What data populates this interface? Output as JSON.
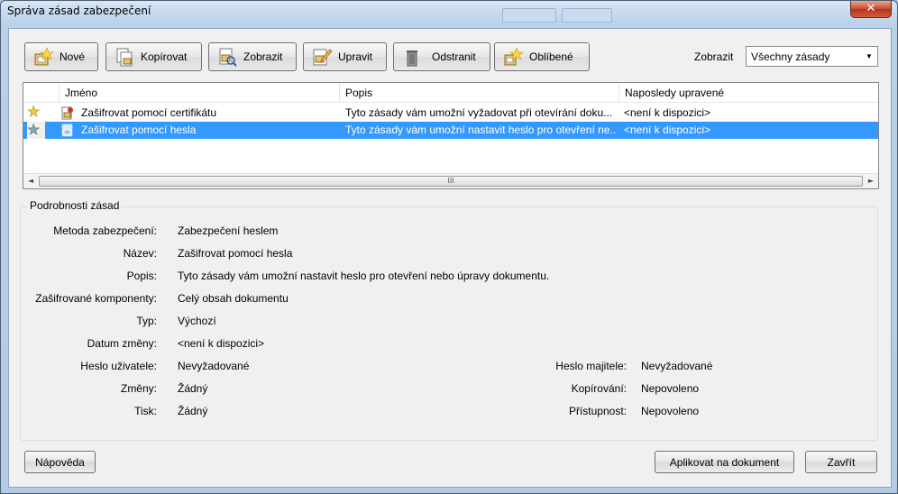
{
  "window": {
    "title": "Správa zásad zabezpečení",
    "close_glyph": "✕"
  },
  "toolbar": {
    "buttons": [
      {
        "label": "Nové",
        "icon": "new-policy-icon"
      },
      {
        "label": "Kopírovat",
        "icon": "copy-policy-icon"
      },
      {
        "label": "Zobrazit",
        "icon": "view-policy-icon"
      },
      {
        "label": "Upravit",
        "icon": "edit-policy-icon"
      },
      {
        "label": "Odstranit",
        "icon": "trash-icon"
      },
      {
        "label": "Oblíbené",
        "icon": "favorite-icon"
      }
    ],
    "show_label": "Zobrazit",
    "show_select": "Všechny zásady"
  },
  "list": {
    "columns": [
      "Jméno",
      "Popis",
      "Naposledy upravené"
    ],
    "rows": [
      {
        "name": "Zašifrovat pomocí certifikátu",
        "description": "Tyto zásady vám umožní vyžadovat při otevírání doku...",
        "modified": "<není k dispozici>",
        "favorite": true,
        "selected": false
      },
      {
        "name": "Zašifrovat pomocí hesla",
        "description": "Tyto zásady vám umožní nastavit heslo pro otevření ne...",
        "modified": "<není k dispozici>",
        "favorite": true,
        "selected": true
      }
    ],
    "scroll_glyph": "III"
  },
  "details": {
    "title": "Podrobnosti zásad",
    "fields": [
      {
        "label": "Metoda zabezpečení:",
        "value": "Zabezpečení heslem"
      },
      {
        "label": "Název:",
        "value": "Zašifrovat pomocí hesla"
      },
      {
        "label": "Popis:",
        "value": "Tyto zásady vám umožní nastavit heslo pro otevření nebo úpravy dokumentu."
      },
      {
        "label": "Zašifrované komponenty:",
        "value": "Celý obsah dokumentu"
      },
      {
        "label": "Typ:",
        "value": "Výchozí"
      },
      {
        "label": "Datum změny:",
        "value": "<není k dispozici>"
      },
      {
        "label": "Heslo uživatele:",
        "value": "Nevyžadované"
      },
      {
        "label": "Změny:",
        "value": "Žádný"
      },
      {
        "label": "Tisk:",
        "value": "Žádný"
      }
    ],
    "right_fields": [
      {
        "label": "Heslo majitele:",
        "value": "Nevyžadované"
      },
      {
        "label": "Kopírování:",
        "value": "Nepovoleno"
      },
      {
        "label": "Přístupnost:",
        "value": "Nepovoleno"
      }
    ]
  },
  "footer": {
    "help": "Nápověda",
    "apply": "Aplikovat na dokument",
    "close": "Zavřít"
  }
}
